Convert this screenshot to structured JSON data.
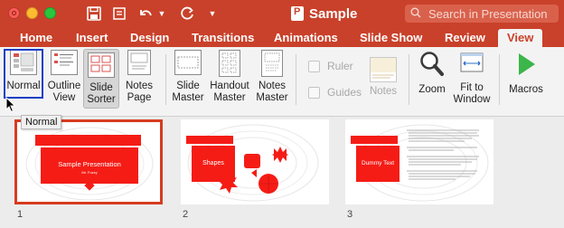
{
  "window": {
    "title": "Sample",
    "search_placeholder": "Search in Presentation"
  },
  "tabs": [
    {
      "label": "Home"
    },
    {
      "label": "Insert"
    },
    {
      "label": "Design"
    },
    {
      "label": "Transitions"
    },
    {
      "label": "Animations"
    },
    {
      "label": "Slide Show"
    },
    {
      "label": "Review"
    },
    {
      "label": "View",
      "active": true
    }
  ],
  "ribbon": {
    "normal": "Normal",
    "outline_1": "Outline",
    "outline_2": "View",
    "sorter_1": "Slide",
    "sorter_2": "Sorter",
    "notes_page_1": "Notes",
    "notes_page_2": "Page",
    "slide_master_1": "Slide",
    "slide_master_2": "Master",
    "handout_master_1": "Handout",
    "handout_master_2": "Master",
    "notes_master_1": "Notes",
    "notes_master_2": "Master",
    "ruler": "Ruler",
    "guides": "Guides",
    "notes": "Notes",
    "zoom": "Zoom",
    "fit_1": "Fit to",
    "fit_2": "Window",
    "macros": "Macros"
  },
  "tooltip": "Normal",
  "slides": [
    {
      "number": "1",
      "title": "Sample Presentation",
      "subtitle": "Mr. Fuzzy",
      "selected": true
    },
    {
      "number": "2",
      "title": "Shapes"
    },
    {
      "number": "3",
      "title": "Dummy Text"
    }
  ],
  "colors": {
    "accent": "#c9412a",
    "slide_red": "#f51c16",
    "selection": "#1e3fc4"
  }
}
